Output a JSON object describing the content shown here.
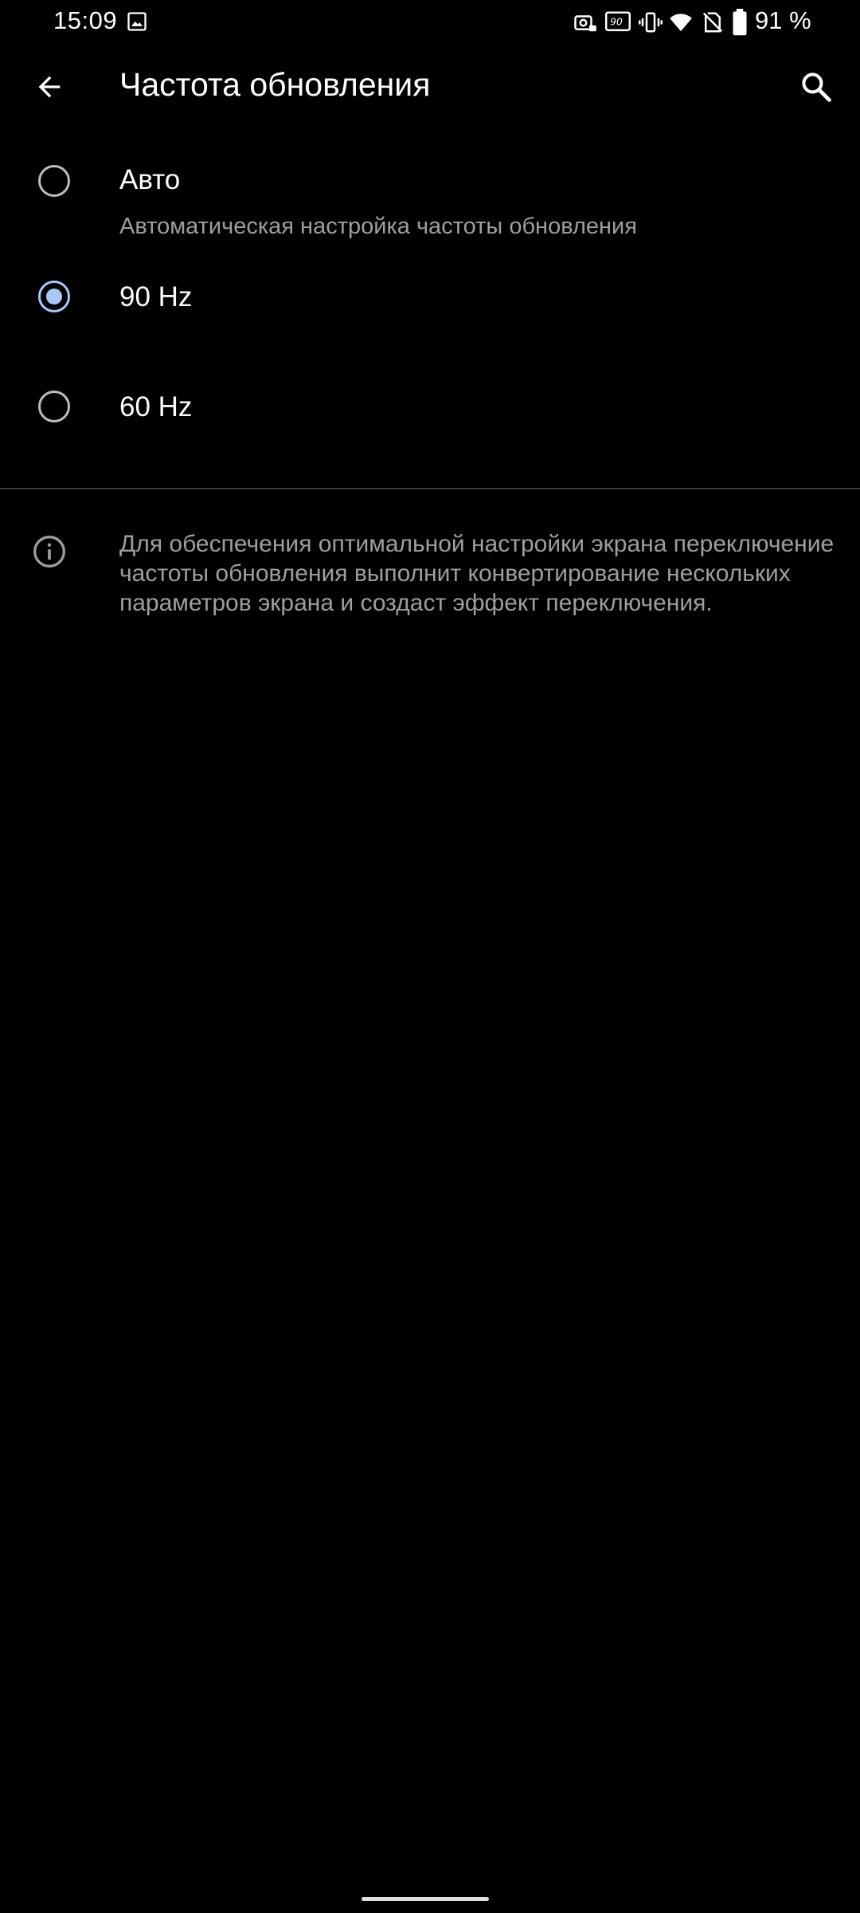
{
  "status_bar": {
    "time": "15:09",
    "battery": "91 %",
    "icons": [
      "gallery-icon",
      "camera-lock-icon",
      "refresh-rate-90-icon",
      "vibrate-icon",
      "wifi-icon",
      "no-sim-icon",
      "battery-icon"
    ]
  },
  "app_bar": {
    "title": "Частота обновления",
    "back_icon": "arrow-back-icon",
    "search_icon": "search-icon"
  },
  "options": [
    {
      "label": "Авто",
      "summary": "Автоматическая настройка частоты обновления",
      "checked": false
    },
    {
      "label": "90 Hz",
      "checked": true
    },
    {
      "label": "60 Hz",
      "checked": false
    }
  ],
  "info": {
    "icon": "info-icon",
    "text": "Для обеспечения оптимальной настройки экрана переключение частоты обновления выполнит конвертирование нескольких параметров экрана и создаст эффект переключения."
  },
  "colors": {
    "background": "#000000",
    "accent": "#a8c7fa",
    "secondary_text": "#9e9e9e"
  }
}
